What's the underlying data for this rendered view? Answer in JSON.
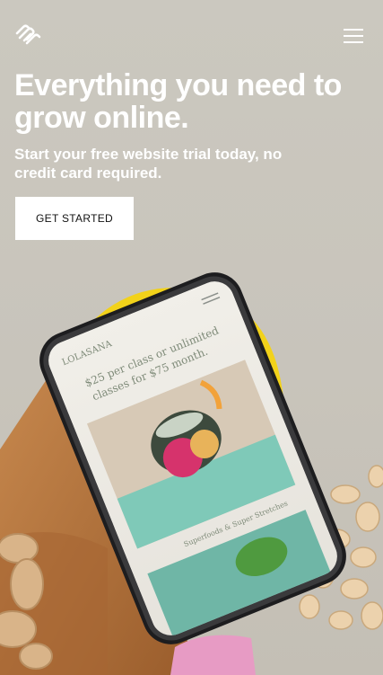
{
  "header": {
    "logo_icon": "squarespace-logo-icon",
    "menu_icon": "hamburger-menu-icon"
  },
  "hero": {
    "headline": "Everything you need to grow online.",
    "subheadline": "Start your free website trial today, no credit card required.",
    "cta_label": "GET STARTED"
  },
  "phone": {
    "brand": "LOLASANA",
    "tagline_line1": "$25 per class or unlimited",
    "tagline_line2": "classes for $75 month.",
    "caption": "Superfoods & Super Stretches"
  },
  "colors": {
    "background": "#c9c6bd",
    "text": "#ffffff",
    "cta_bg": "#ffffff",
    "cta_text": "#111111",
    "accent_yellow": "#f2d21a",
    "cork": "#b9763f"
  }
}
